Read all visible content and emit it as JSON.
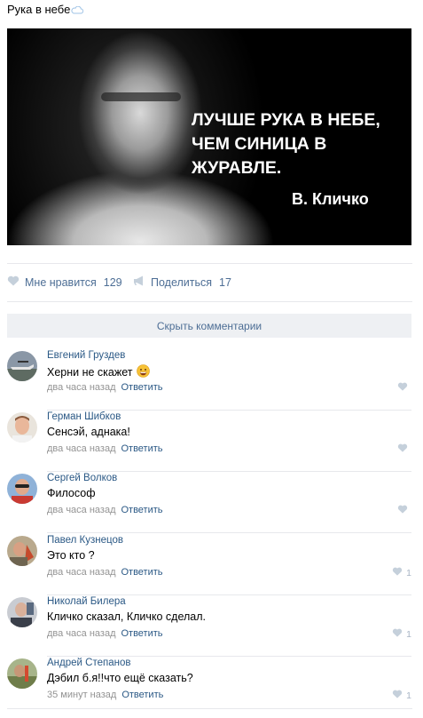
{
  "post": {
    "text": "Рука в небе",
    "image": {
      "quote_lines": [
        "ЛУЧШЕ РУКА В НЕБЕ,",
        "ЧЕМ СИНИЦА В",
        "ЖУРАВЛЕ."
      ],
      "author": "В. Кличко"
    },
    "actions": {
      "like_label": "Мне нравится",
      "like_count": "129",
      "share_label": "Поделиться",
      "share_count": "17"
    },
    "hide_comments_label": "Скрыть комментарии"
  },
  "comments": [
    {
      "author": "Евгений Груздев",
      "text": "Херни не скажет",
      "time": "два часа назад",
      "reply": "Ответить",
      "likes": ""
    },
    {
      "author": "Герман Шибков",
      "text": "Сенсэй, аднака!",
      "time": "два часа назад",
      "reply": "Ответить",
      "likes": ""
    },
    {
      "author": "Сергей Волков",
      "text": "Философ",
      "time": "два часа назад",
      "reply": "Ответить",
      "likes": ""
    },
    {
      "author": "Павел Кузнецов",
      "text": "Это кто ?",
      "time": "два часа назад",
      "reply": "Ответить",
      "likes": "1"
    },
    {
      "author": "Николай Билера",
      "text": "Кличко сказал, Кличко сделал.",
      "time": "два часа назад",
      "reply": "Ответить",
      "likes": "1"
    },
    {
      "author": "Андрей Степанов",
      "text": "Дэбил б.я!!что ещё сказать?",
      "time": "35 минут назад",
      "reply": "Ответить",
      "likes": "1"
    }
  ],
  "icons": {
    "cloud": "cloud-icon",
    "like": "heart-icon",
    "share": "megaphone-icon",
    "emoji": "smile-emoji-icon"
  },
  "colors": {
    "link": "#2a5885",
    "action": "#4d6e95",
    "muted": "#939393",
    "divider": "#e7e8ec"
  }
}
